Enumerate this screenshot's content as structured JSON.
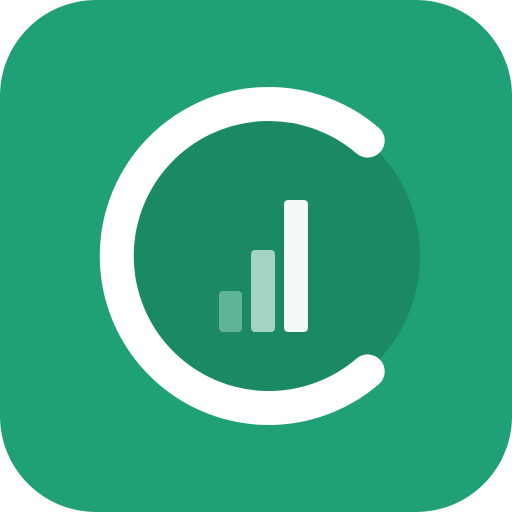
{
  "icon": {
    "name": "app-icon",
    "glyph": "signal-bars-in-ring",
    "colors": {
      "tile": "#1fa077",
      "disc": "#1b8a63",
      "ring": "#ffffff",
      "bar_short": "#5fb398",
      "bar_mid": "#a3d4c3",
      "bar_tall": "#f4faf7"
    },
    "signal_level": {
      "bars_total": 3,
      "bars_shown": 3
    }
  }
}
